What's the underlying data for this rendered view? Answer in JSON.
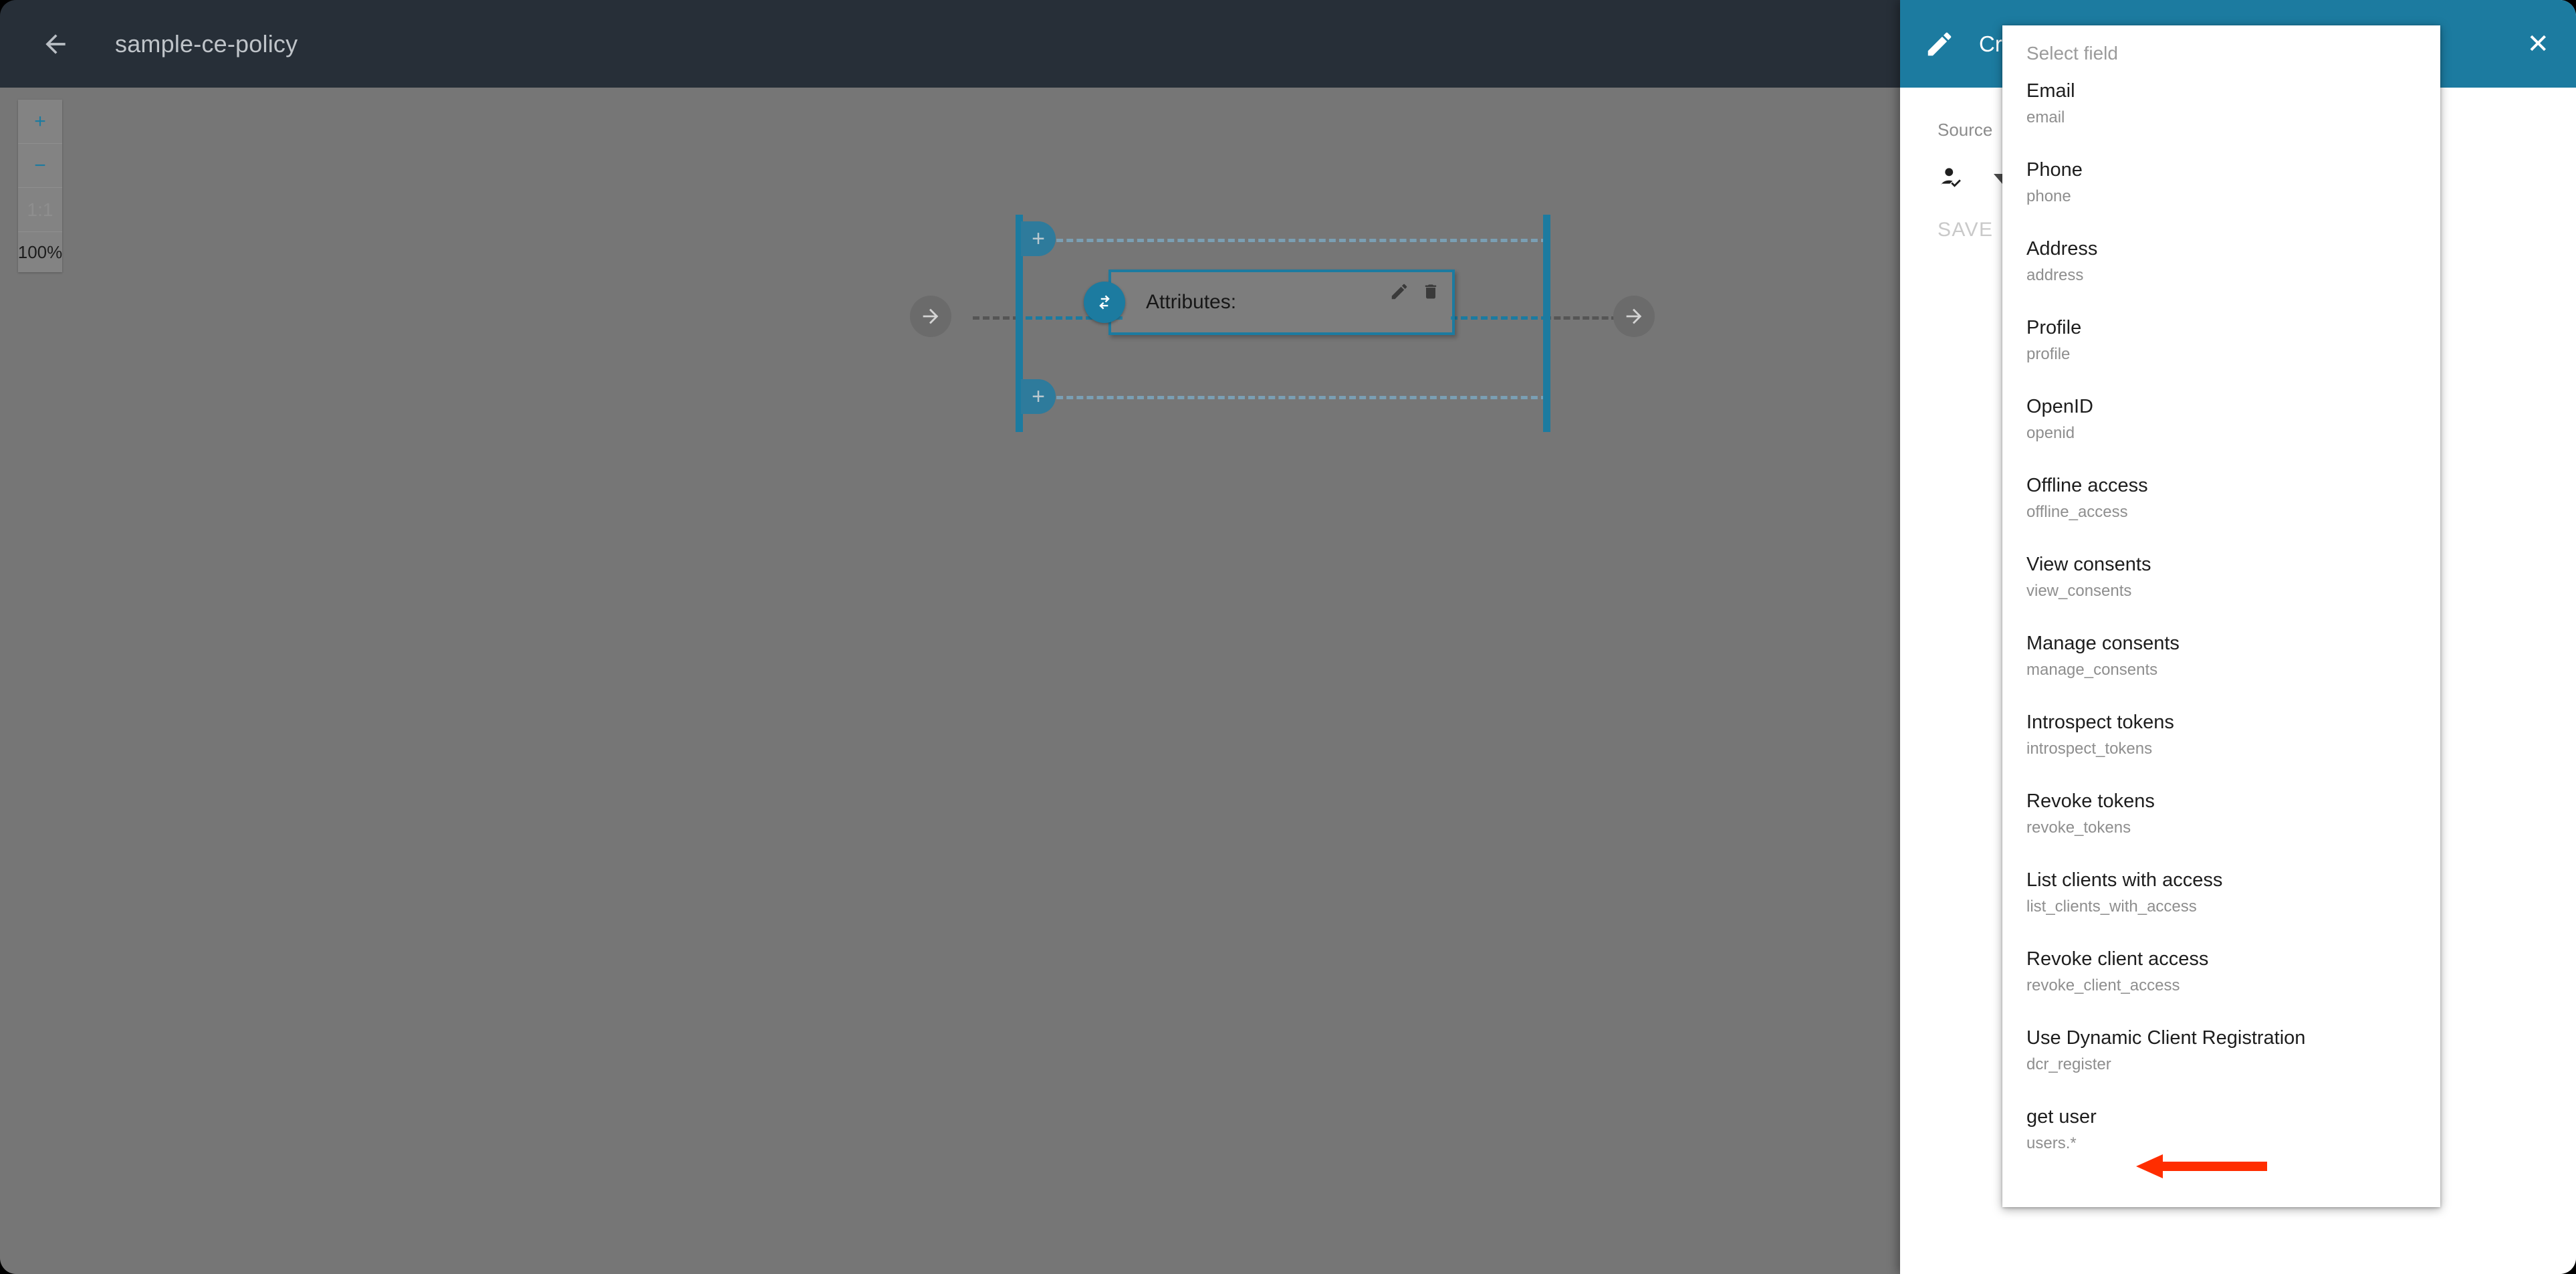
{
  "window": {
    "title": "sample-ce-policy",
    "back_icon": "arrow-left-icon"
  },
  "canvas": {
    "zoom_controls": {
      "zoom_in": "+",
      "zoom_out": "−",
      "reset_ratio": "1:1",
      "zoom_level": "100%"
    },
    "nodes": {
      "attributes_label": "Attributes:",
      "edit_icon": "pencil-icon",
      "delete_icon": "trash-icon",
      "join_icon": "merge-arrows-icon",
      "start_icon": "arrow-right-icon",
      "end_icon": "arrow-right-icon",
      "add_branch_top": "+",
      "add_branch_bottom": "+"
    },
    "colors": {
      "accent": "#1c7ba0",
      "canvas_bg": "#767676",
      "topbar_bg": "#272f38"
    }
  },
  "panel": {
    "title": "Cross context condition",
    "edit_icon": "pencil-icon",
    "close_icon": "close-icon",
    "header_color": "#1c7ba0",
    "source_label": "Source",
    "source_icon": "person-check-icon",
    "source_caret": "chevron-down-icon",
    "save_label": "SAVE"
  },
  "dropdown": {
    "placeholder": "Select field",
    "items": [
      {
        "label": "Email",
        "value": "email"
      },
      {
        "label": "Phone",
        "value": "phone"
      },
      {
        "label": "Address",
        "value": "address"
      },
      {
        "label": "Profile",
        "value": "profile"
      },
      {
        "label": "OpenID",
        "value": "openid"
      },
      {
        "label": "Offline access",
        "value": "offline_access"
      },
      {
        "label": "View consents",
        "value": "view_consents"
      },
      {
        "label": "Manage consents",
        "value": "manage_consents"
      },
      {
        "label": "Introspect tokens",
        "value": "introspect_tokens"
      },
      {
        "label": "Revoke tokens",
        "value": "revoke_tokens"
      },
      {
        "label": "List clients with access",
        "value": "list_clients_with_access"
      },
      {
        "label": "Revoke client access",
        "value": "revoke_client_access"
      },
      {
        "label": "Use Dynamic Client Registration",
        "value": "dcr_register"
      },
      {
        "label": "get user",
        "value": "users.*"
      }
    ]
  },
  "annotation": {
    "arrow_color": "#ff2d00",
    "points_to": "get user"
  }
}
